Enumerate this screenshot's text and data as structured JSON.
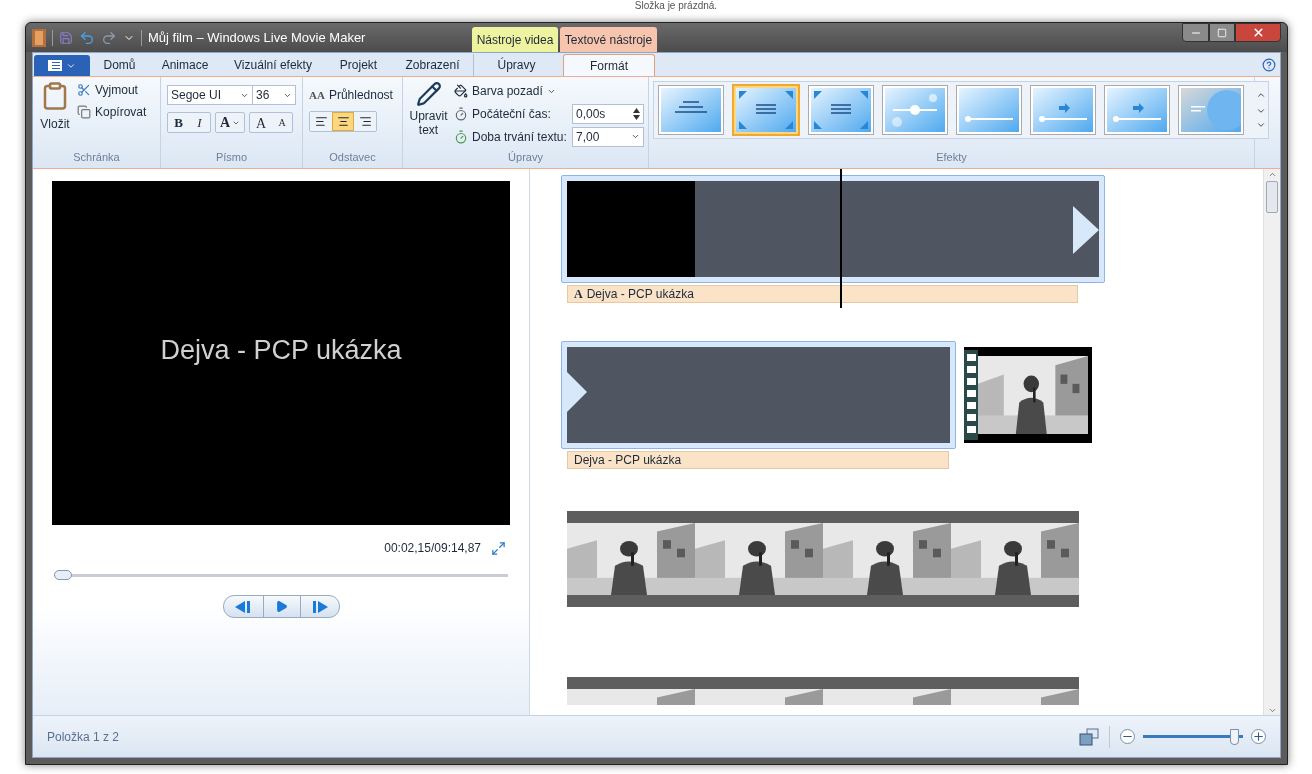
{
  "desktop_text": "Složka je prázdná.",
  "window": {
    "title": "Můj film – Windows Live Movie Maker"
  },
  "context_tabs": [
    {
      "label": "Nástroje videa",
      "color": "#eef3a0"
    },
    {
      "label": "Textové nástroje",
      "color": "#f7c4ae"
    }
  ],
  "tabs": [
    {
      "label": "Domů",
      "selected": false
    },
    {
      "label": "Animace",
      "selected": false
    },
    {
      "label": "Vizuální efekty",
      "selected": false
    },
    {
      "label": "Projekt",
      "selected": false
    },
    {
      "label": "Zobrazení",
      "selected": false
    },
    {
      "label": "Úpravy",
      "selected": false
    },
    {
      "label": "Formát",
      "selected": true
    }
  ],
  "ribbon": {
    "clipboard": {
      "label": "Schránka",
      "paste": "Vložit",
      "cut": "Vyjmout",
      "copy": "Kopírovat"
    },
    "font": {
      "label": "Písmo",
      "family": "Segoe UI",
      "size": "36",
      "bold": "B",
      "italic": "I",
      "font_colour_letter": "A",
      "grow": "A",
      "shrink": "A"
    },
    "paragraph": {
      "label": "Odstavec",
      "transparency_glyph": "AA",
      "transparency": "Průhlednost",
      "align": [
        {
          "kind": "left",
          "selected": false
        },
        {
          "kind": "center",
          "selected": true
        },
        {
          "kind": "right",
          "selected": false
        }
      ]
    },
    "adjust": {
      "label": "Úpravy",
      "edit_text": "Upravit text",
      "background": "Barva pozadí",
      "start_label": "Počáteční čas:",
      "start_value": "0,00s",
      "duration_label": "Doba trvání textu:",
      "duration_value": "7,00"
    },
    "effects": {
      "label": "Efekty",
      "items": [
        {
          "kind": "fly",
          "selected": false
        },
        {
          "kind": "zoom",
          "selected": true
        },
        {
          "kind": "zoom2",
          "selected": false
        },
        {
          "kind": "burst",
          "selected": false
        },
        {
          "kind": "shine",
          "selected": false
        },
        {
          "kind": "swoosh",
          "selected": false
        },
        {
          "kind": "swoosh2",
          "selected": false
        },
        {
          "kind": "curtain",
          "selected": false
        }
      ]
    }
  },
  "preview": {
    "text": "Dejva - PCP ukázka",
    "time": "00:02,15/09:14,87",
    "seek": {
      "level": 0.0
    }
  },
  "timeline": [
    {
      "kind": "opening_title",
      "caption_glyph": "A",
      "caption": "Dejva - PCP ukázka"
    },
    {
      "kind": "title_with_video",
      "caption": "Dejva - PCP ukázka"
    },
    {
      "kind": "video"
    },
    {
      "kind": "video_cut"
    }
  ],
  "status_bar": {
    "text": "Položka 1 z 2",
    "zoom": {
      "level": 0.96
    }
  }
}
